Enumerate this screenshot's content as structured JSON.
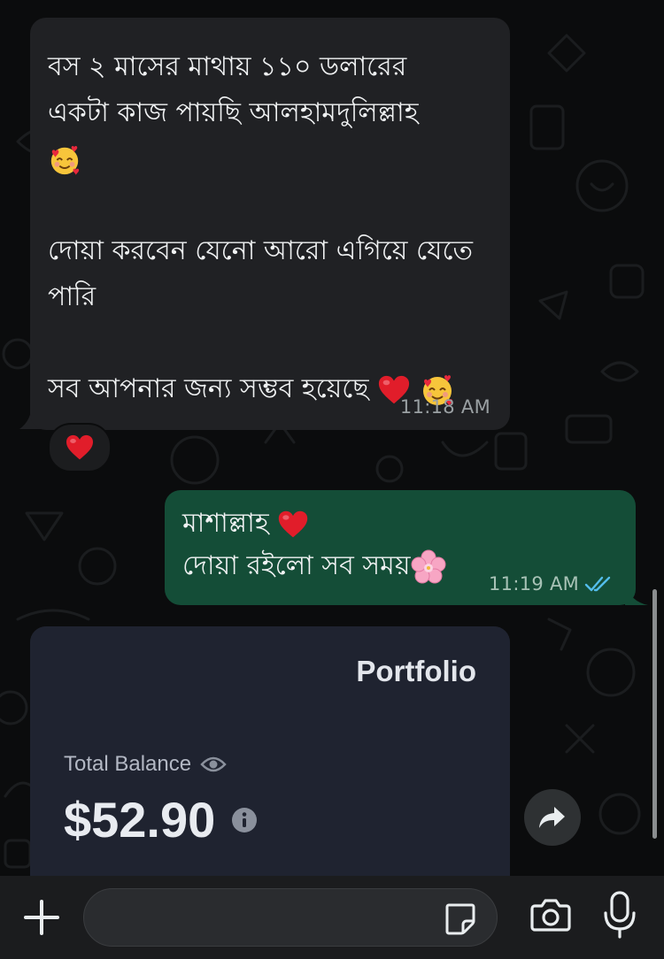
{
  "messages": [
    {
      "direction": "incoming",
      "text_lines": [
        "বস ২ মাসের মাথায় ১১০ ডলারের",
        "একটা কাজ পায়ছি আলহামদুলিল্লাহ"
      ],
      "paragraph2": "দোয়া করবেন যেনো আরো এগিয়ে যেতে\nপারি",
      "paragraph3": "সব আপনার জন্য সম্ভব হয়েছে",
      "emojis": [
        "smiling-face-with-hearts",
        "red-heart"
      ],
      "time": "11:18 AM",
      "reaction": "red-heart"
    },
    {
      "direction": "outgoing",
      "line1": "মাশাল্লাহ",
      "line2": "দোয়া রইলো সব সময়",
      "emojis": [
        "red-heart",
        "cherry-blossom"
      ],
      "time": "11:19 AM",
      "status": "read-double-check"
    },
    {
      "direction": "incoming",
      "type": "image",
      "image": {
        "title": "Portfolio",
        "balance_label": "Total Balance",
        "balance_value": "$52.90"
      }
    }
  ],
  "input": {
    "placeholder": "",
    "value": ""
  },
  "colors": {
    "background": "#0b0c0d",
    "incoming_bubble": "#202124",
    "outgoing_bubble": "#144d37",
    "read_ticks": "#53bdeb",
    "card_background": "#1f2330"
  }
}
